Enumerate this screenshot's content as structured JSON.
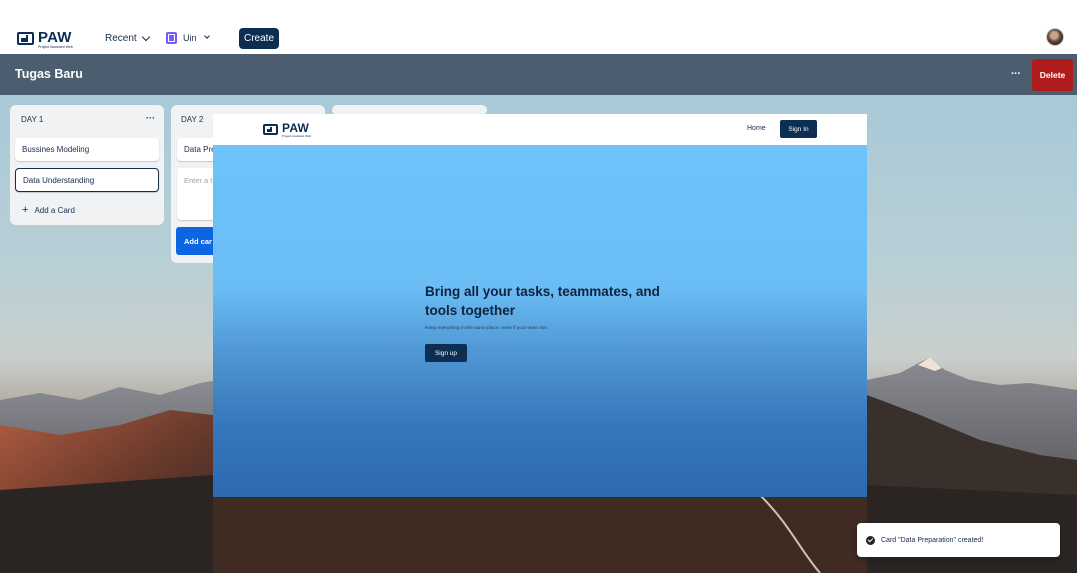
{
  "app": {
    "logo_title": "PAW",
    "logo_subtitle": "Project Assistant Web",
    "recent_label": "Recent",
    "workspace_label": "Uin",
    "create_label": "Create"
  },
  "board": {
    "title": "Tugas Baru",
    "more_label": "···",
    "delete_label": "Delete"
  },
  "lists": [
    {
      "title": "DAY 1",
      "menu": "···",
      "cards": [
        "Bussines Modeling",
        "Data Understanding"
      ],
      "add_card_label": "Add a Card"
    },
    {
      "title": "DAY 2",
      "cards": [
        "Data Pre"
      ],
      "composer_placeholder": "Enter a t",
      "add_card_button": "Add car"
    }
  ],
  "overlay": {
    "logo_title": "PAW",
    "logo_subtitle": "Project Assistant Web",
    "nav_home": "Home",
    "nav_signin": "Sign In",
    "headline": "Bring all your tasks, teammates, and tools together",
    "subtext": "Keep everything in the same place, even if your team isnt",
    "signup_label": "Sign up",
    "hero_colors": [
      "#6ec3fb",
      "#2c6aaf"
    ]
  },
  "toast": {
    "icon": "check-circle-icon",
    "message": "Card \"Data Preparation\" created!"
  },
  "colors": {
    "brand_navy": "#0b2e52",
    "delete_red": "#b01c1c",
    "header_slate": "#4c5d6f",
    "primary_blue": "#0c66e4"
  }
}
